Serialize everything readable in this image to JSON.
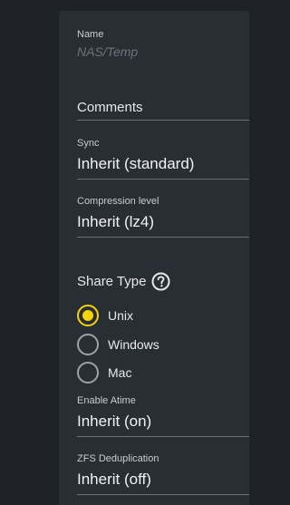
{
  "form": {
    "name": {
      "label": "Name",
      "value": "NAS/Temp"
    },
    "comments": {
      "label": "Comments"
    },
    "sync": {
      "label": "Sync",
      "value": "Inherit (standard)"
    },
    "compression": {
      "label": "Compression level",
      "value": "Inherit (lz4)"
    },
    "share_type": {
      "title": "Share Type",
      "help_icon": "help-circle-icon",
      "options": [
        {
          "label": "Unix",
          "checked": true
        },
        {
          "label": "Windows",
          "checked": false
        },
        {
          "label": "Mac",
          "checked": false
        }
      ],
      "accent_color": "#f5d30f"
    },
    "atime": {
      "label": "Enable Atime",
      "value": "Inherit (on)"
    },
    "dedup": {
      "label": "ZFS Deduplication",
      "value": "Inherit (off)"
    }
  }
}
